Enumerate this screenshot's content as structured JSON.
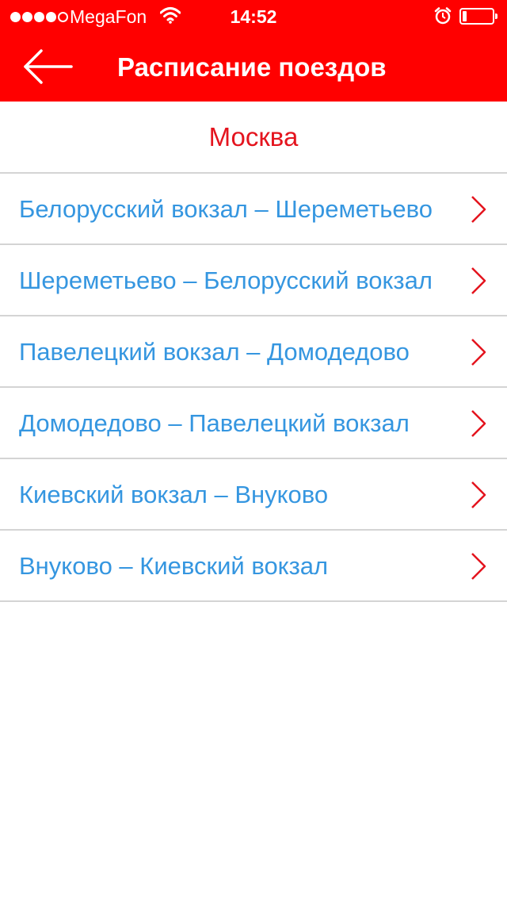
{
  "status_bar": {
    "carrier": "MegaFon",
    "time": "14:52",
    "signal_bars_filled": 4,
    "signal_bars_total": 5,
    "battery_level": 0.15,
    "icons": [
      "wifi-icon",
      "alarm-icon",
      "battery-icon"
    ]
  },
  "header": {
    "title": "Расписание поездов",
    "back_icon": "arrow-left-icon"
  },
  "section": {
    "title": "Москва"
  },
  "routes": [
    {
      "label": "Белорусский вокзал – Шереметьево"
    },
    {
      "label": "Шереметьево – Белорусский вокзал"
    },
    {
      "label": "Павелецкий вокзал – Домодедово"
    },
    {
      "label": "Домодедово – Павелецкий вокзал"
    },
    {
      "label": "Киевский вокзал – Внуково"
    },
    {
      "label": "Внуково – Киевский вокзал"
    }
  ],
  "colors": {
    "header_bg": "#ff0000",
    "section_title": "#e4141e",
    "route_text": "#3596e0",
    "chevron": "#e4141e",
    "separator": "#d4d4d4"
  }
}
